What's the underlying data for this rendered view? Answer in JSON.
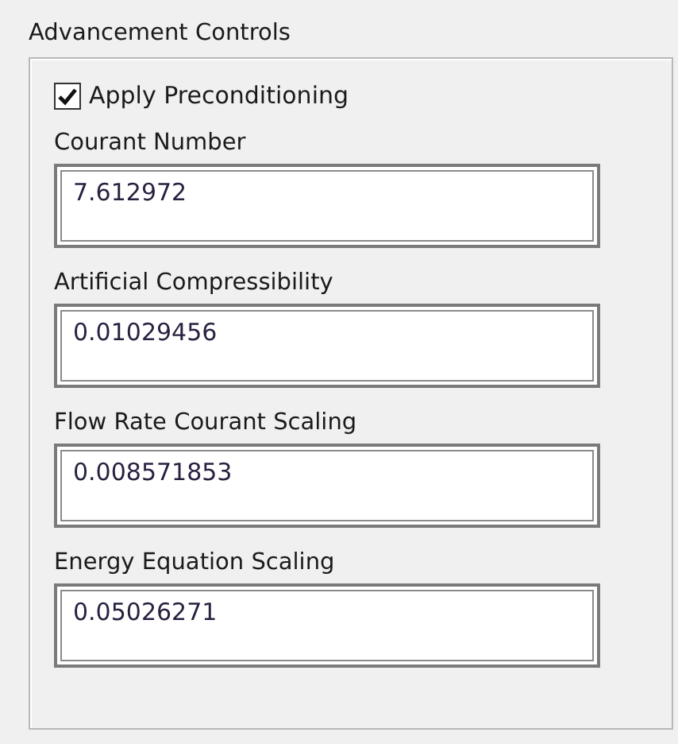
{
  "group": {
    "title": "Advancement Controls"
  },
  "checkbox": {
    "label": "Apply Preconditioning",
    "checked": true
  },
  "fields": [
    {
      "label": "Courant Number",
      "value": "7.612972"
    },
    {
      "label": "Artificial Compressibility",
      "value": "0.01029456"
    },
    {
      "label": "Flow Rate Courant Scaling",
      "value": "0.008571853"
    },
    {
      "label": "Energy Equation Scaling",
      "value": "0.05026271"
    }
  ]
}
